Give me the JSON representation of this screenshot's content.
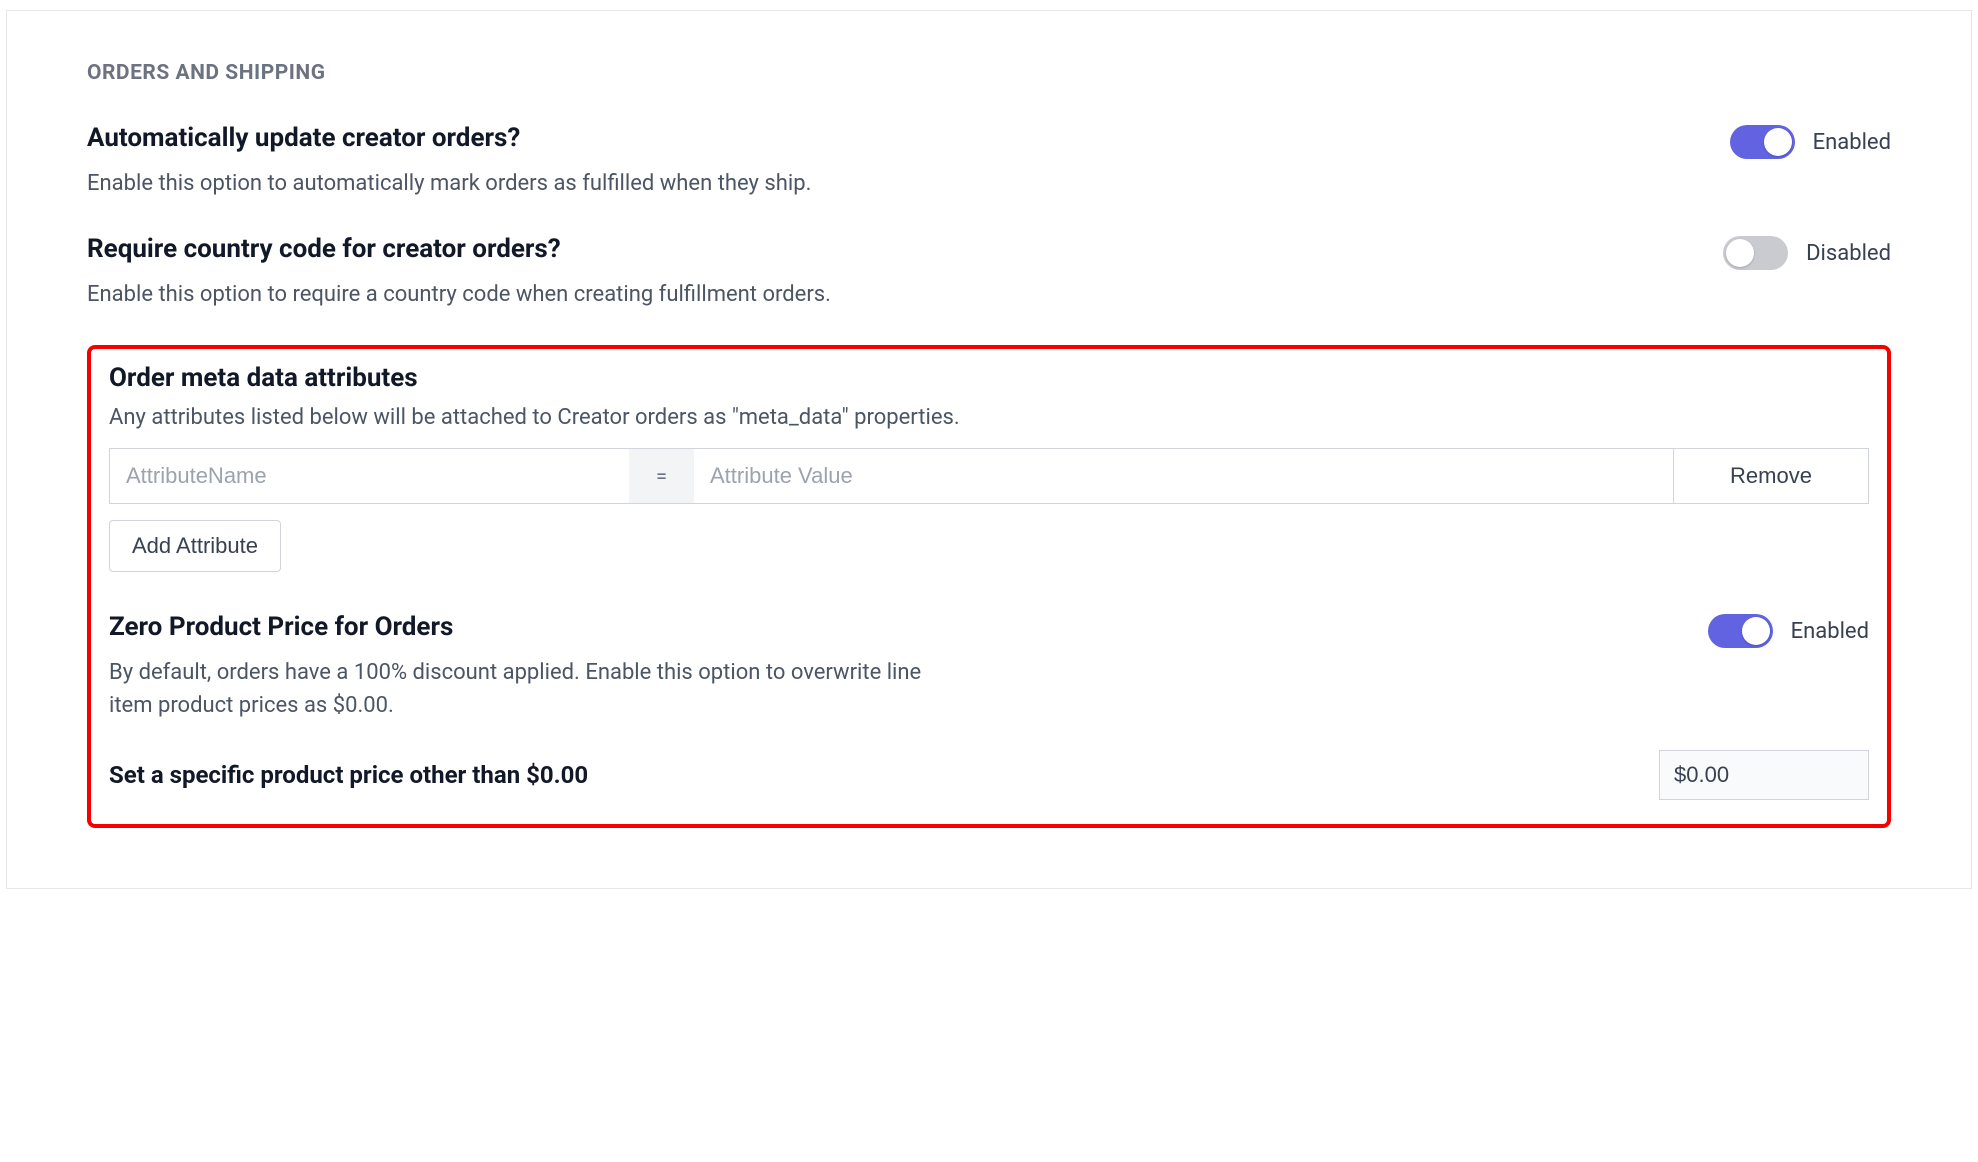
{
  "section": {
    "heading": "ORDERS AND SHIPPING"
  },
  "settings": {
    "auto_update": {
      "title": "Automatically update creator orders?",
      "desc": "Enable this option to automatically mark orders as fulfilled when they ship.",
      "state_label": "Enabled"
    },
    "require_country": {
      "title": "Require country code for creator orders?",
      "desc": "Enable this option to require a country code when creating fulfillment orders.",
      "state_label": "Disabled"
    }
  },
  "meta": {
    "title": "Order meta data attributes",
    "desc": "Any attributes listed below will be attached to Creator orders as \"meta_data\" properties.",
    "name_placeholder": "AttributeName",
    "eq": "=",
    "value_placeholder": "Attribute Value",
    "remove_label": "Remove",
    "add_label": "Add Attribute"
  },
  "zero_price": {
    "title": "Zero Product Price for Orders",
    "desc": "By default, orders have a 100% discount applied. Enable this option to overwrite line item product prices as $0.00.",
    "state_label": "Enabled"
  },
  "specific_price": {
    "title": "Set a specific product price other than $0.00",
    "value": "$0.00"
  }
}
